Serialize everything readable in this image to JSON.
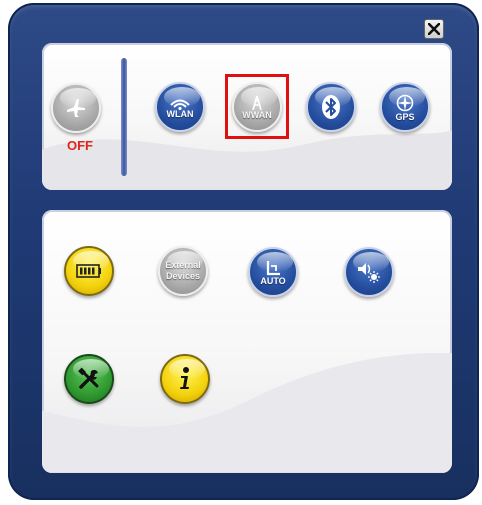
{
  "window": {
    "close_icon": "close-icon"
  },
  "wireless": {
    "airplane": {
      "icon": "airplane-icon",
      "state_label": "OFF"
    },
    "wlan": {
      "label": "WLAN",
      "icon": "wifi-icon"
    },
    "wwan": {
      "label": "WWAN",
      "icon": "antenna-icon",
      "state": "disabled"
    },
    "bluetooth": {
      "icon": "bluetooth-icon"
    },
    "gps": {
      "label": "GPS",
      "icon": "compass-icon"
    }
  },
  "system": {
    "battery": {
      "icon": "battery-icon"
    },
    "external_devices": {
      "label_line1": "External",
      "label_line2": "Devices",
      "state": "disabled"
    },
    "auto_brightness": {
      "label": "AUTO",
      "icon": "brightness-auto-icon"
    },
    "volume_brightness": {
      "icon": "volume-brightness-icon"
    },
    "tools": {
      "icon": "tools-icon"
    },
    "info": {
      "icon": "info-icon"
    }
  },
  "colors": {
    "frame": "#1f3a75",
    "button_blue": "#254e9f",
    "highlight": "#e01010",
    "off_text": "#e0261c"
  }
}
